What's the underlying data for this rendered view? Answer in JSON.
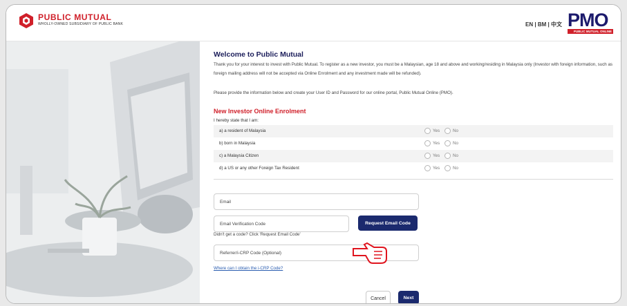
{
  "header": {
    "brand_name": "PUBLIC MUTUAL",
    "brand_sub": "WHOLLY-OWNED SUBSIDIARY OF PUBLIC BANK",
    "lang_en": "EN",
    "lang_bm": "BM",
    "lang_zh": "中文",
    "lang_sep": "|",
    "pmo_logo": "PMO",
    "pmo_sub": "PUBLIC MUTUAL ONLINE"
  },
  "welcome": {
    "title": "Welcome to Public Mutual",
    "intro": "Thank you for your interest to invest with Public Mutual. To register as a new investor, you must be a Malaysian, age 18 and above and working/residing in Malaysia only (Investor with foreign information, such as foreign mailing address will not be accepted via Online Enrolment and any investment made will be refunded).",
    "intro2": "Please provide the information below and create your User ID and Password for our online portal, Public Mutual Online (PMO)."
  },
  "enrolment": {
    "title": "New Investor Online Enrolment",
    "statement": "I hereby state that I am:",
    "yes_label": "Yes",
    "no_label": "No",
    "questions": [
      {
        "label": "a) a resident of Malaysia"
      },
      {
        "label": "b) born in Malaysia"
      },
      {
        "label": "c) a Malaysia Citizen"
      },
      {
        "label": "d) a US or any other Foreign Tax Resident"
      }
    ]
  },
  "form": {
    "email_placeholder": "Email",
    "verification_placeholder": "Email Verification Code",
    "request_code_label": "Request Email Code",
    "no_code_hint": "Didn't get a code? Click 'Request Email Code'",
    "referrer_placeholder": "Referrer/i-CRP Code (Optional)",
    "icrp_link": "Where can I obtain the i-CRP Code?",
    "cancel_label": "Cancel",
    "next_label": "Next"
  },
  "colors": {
    "brand_red": "#d0202a",
    "navy": "#1b2a6e",
    "link": "#2a5db0"
  }
}
